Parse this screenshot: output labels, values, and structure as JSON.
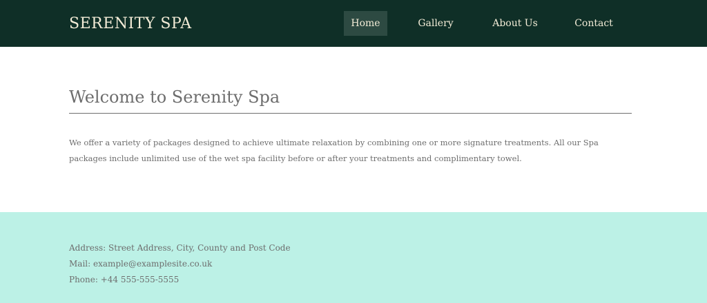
{
  "header": {
    "brand": "SERENITY SPA",
    "nav": [
      {
        "label": "Home",
        "active": true
      },
      {
        "label": "Gallery",
        "active": false
      },
      {
        "label": "About Us",
        "active": false
      },
      {
        "label": "Contact",
        "active": false
      }
    ]
  },
  "main": {
    "title": "Welcome to Serenity Spa",
    "intro": "We offer a variety of packages designed to achieve ultimate relaxation by combining one or more signature treatments. All our Spa packages include unlimited use of the wet spa facility before or after your treatments and complimentary towel."
  },
  "footer": {
    "address": "Address: Street Address, City, County and Post Code",
    "mail": "Mail: example@examplesite.co.uk",
    "phone": "Phone: +44 555-555-5555"
  },
  "colors": {
    "header_bg": "#0f2f27",
    "nav_active_bg": "#2d4a42",
    "header_text": "#f3ecd7",
    "body_text": "#6d6d6d",
    "footer_bg": "#bcf1e6"
  }
}
